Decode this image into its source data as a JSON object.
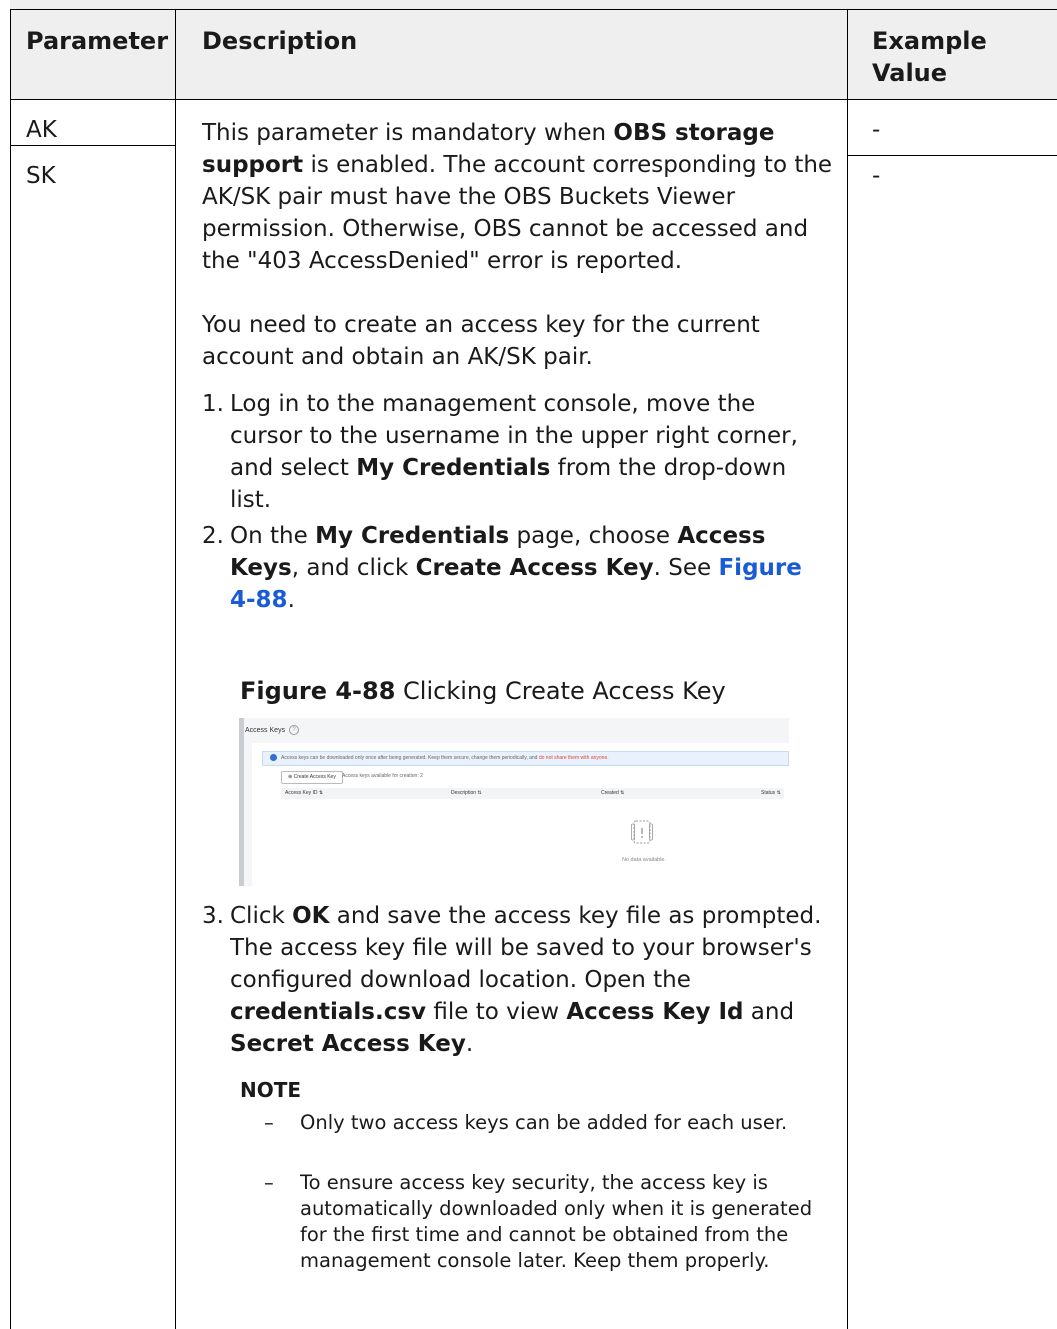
{
  "table": {
    "headers": {
      "parameter": "Parameter",
      "description": "Description",
      "example_value": "Example Value"
    },
    "rows": [
      {
        "parameter": "AK",
        "example": "-"
      },
      {
        "parameter": "SK",
        "example": "-"
      }
    ]
  },
  "description": {
    "para1": {
      "pre": "This parameter is mandatory when ",
      "bold": "OBS storage support",
      "post": " is enabled. The account corresponding to the AK/SK pair must have the OBS Buckets Viewer permission. Otherwise, OBS cannot be accessed and the \"403 AccessDenied\" error is reported."
    },
    "para2": "You need to create an access key for the current account and obtain an AK/SK pair.",
    "step1": {
      "num": "1.",
      "pre": "Log in to the management console, move the cursor to the username in the upper right corner, and select ",
      "bold": "My Credentials",
      "post": " from the drop-down list."
    },
    "step2": {
      "num": "2.",
      "t1": "On the ",
      "b1": "My Credentials",
      "t2": " page, choose ",
      "b2": "Access Keys",
      "t3": ", and click ",
      "b3": "Create Access Key",
      "t4": ". See ",
      "link": "Figure 4-88",
      "t5": "."
    },
    "figure_caption": {
      "label": "Figure 4-88",
      "text": " Clicking Create Access Key"
    },
    "figure": {
      "title": "Access Keys",
      "info_text": "Access keys can be downloaded only once after being generated. Keep them secure, change them periodically, and ",
      "info_red": "do not share them with anyone.",
      "create_button": "Create Access Key",
      "available_text": "Access keys available for creation: 2",
      "columns": [
        "Access Key ID",
        "Description",
        "Created",
        "Status"
      ],
      "empty_text": "No data available."
    },
    "step3": {
      "num": "3.",
      "t1": "Click ",
      "b1": "OK",
      "t2": " and save the access key file as prompted. The access key file will be saved to your browser's configured download location. Open the ",
      "b2": "credentials.csv",
      "t3": " file to view ",
      "b3": "Access Key Id",
      "t4": " and ",
      "b4": "Secret Access Key",
      "t5": "."
    },
    "note": {
      "title": "NOTE",
      "items": [
        "Only two access keys can be added for each user.",
        "To ensure access key security, the access key is automatically downloaded only when it is generated for the first time and cannot be obtained from the management console later. Keep them properly."
      ]
    }
  }
}
